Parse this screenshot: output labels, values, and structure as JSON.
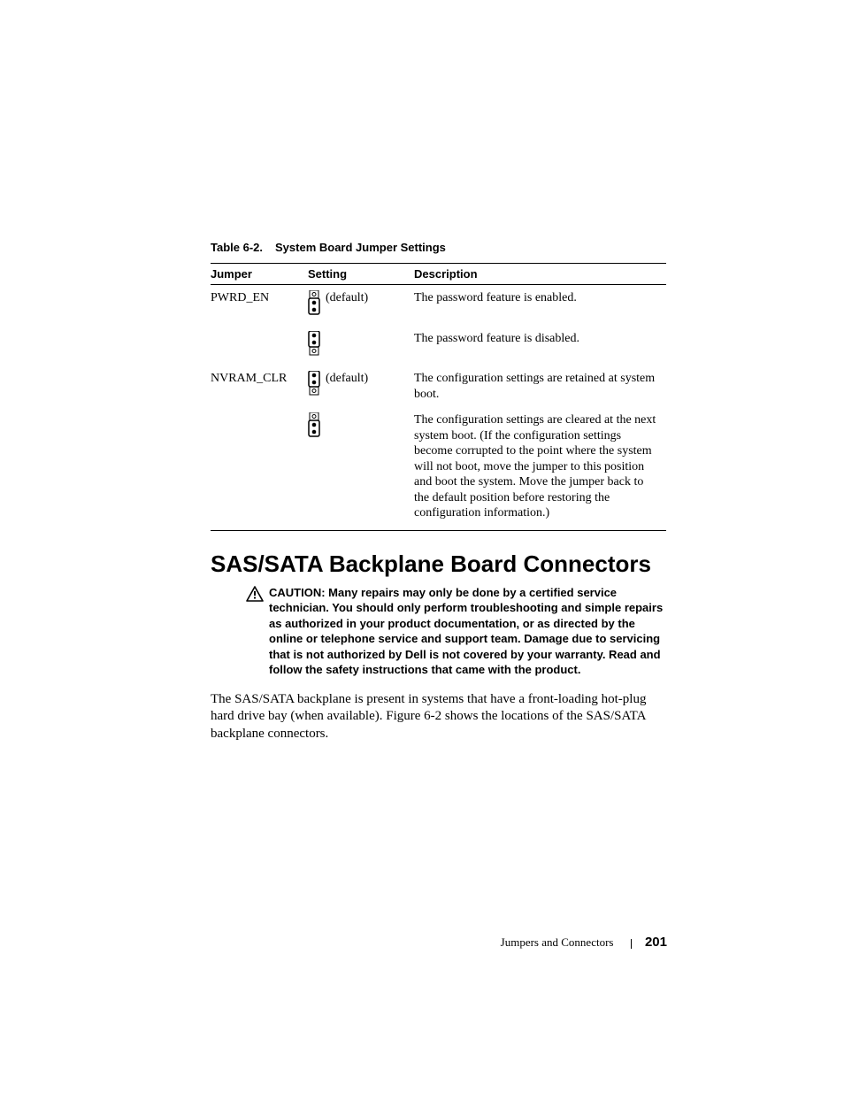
{
  "table": {
    "number": "Table 6-2.",
    "title": "System Board Jumper Settings",
    "headers": {
      "c1": "Jumper",
      "c2": "Setting",
      "c3": "Description"
    },
    "rows": [
      {
        "jumper": "PWRD_EN",
        "setting": "(default)",
        "desc": "The password feature is enabled."
      },
      {
        "jumper": "",
        "setting": "",
        "desc": "The password feature is disabled."
      },
      {
        "jumper": "NVRAM_CLR",
        "setting": "(default)",
        "desc": "The configuration settings are retained at system boot."
      },
      {
        "jumper": "",
        "setting": "",
        "desc": "The configuration settings are cleared at the next system boot. (If the configuration settings become corrupted to the point where the system will not boot, move the jumper to this position and boot the system. Move the jumper back to the default position before restoring the configuration information.)"
      }
    ]
  },
  "section_heading": "SAS/SATA Backplane Board Connectors",
  "caution": {
    "label": "CAUTION:",
    "text": "Many repairs may only be done by a certified service technician. You should only perform troubleshooting and simple repairs as authorized in your product documentation, or as directed by the online or telephone service and support team. Damage due to servicing that is not authorized by Dell is not covered by your warranty. Read and follow the safety instructions that came with the product."
  },
  "body_paragraph": "The SAS/SATA backplane is present in systems that have a front-loading hot-plug hard drive bay (when available). Figure 6-2 shows the locations of the SAS/SATA backplane connectors.",
  "footer": {
    "section": "Jumpers and Connectors",
    "page": "201"
  }
}
